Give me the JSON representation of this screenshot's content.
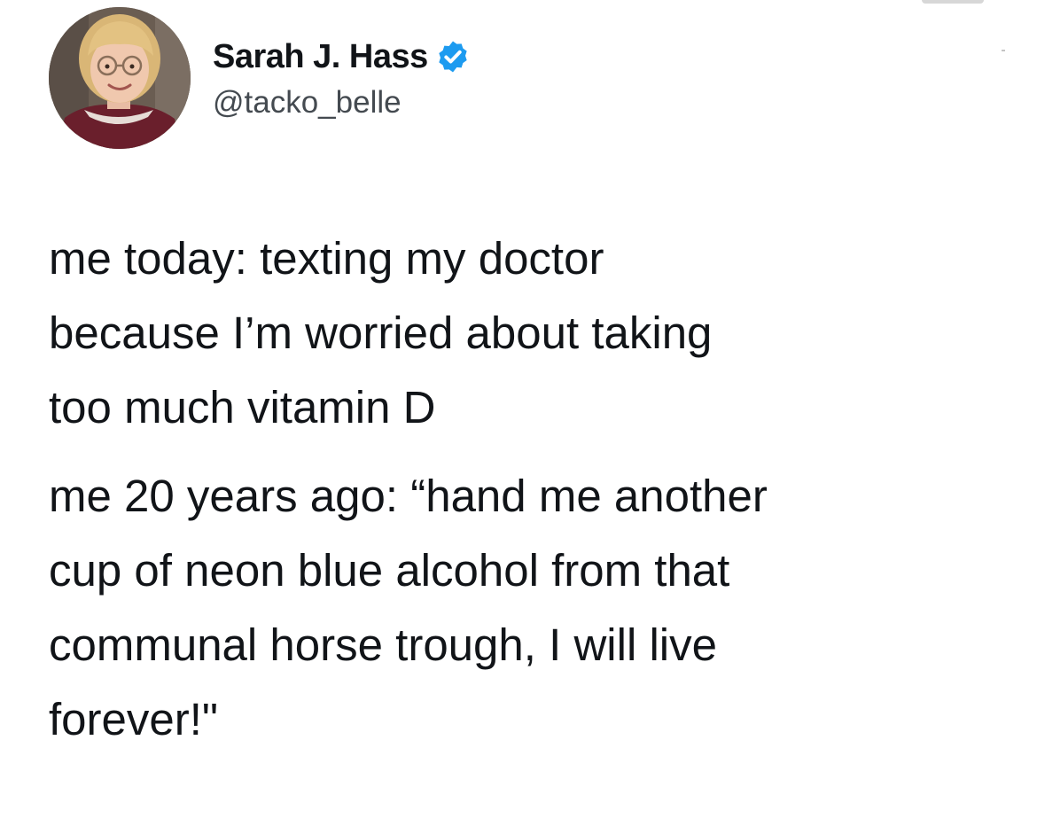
{
  "author": {
    "display_name": "Sarah J. Hass",
    "handle": "@tacko_belle",
    "verified_icon": "verified-badge-icon",
    "avatar_icon": "profile-photo-child-with-glasses"
  },
  "tweet": {
    "paragraphs": [
      "me today: texting my doctor\nbecause I’m worried about taking\ntoo much vitamin D",
      "me 20 years ago: “hand me another\ncup of neon blue alcohol from that\ncommunal horse trough, I will live\nforever!\""
    ]
  },
  "colors": {
    "text": "#111418",
    "handle_text": "#444a50",
    "verified_badge": "#1d9bf0",
    "background": "#ffffff"
  }
}
